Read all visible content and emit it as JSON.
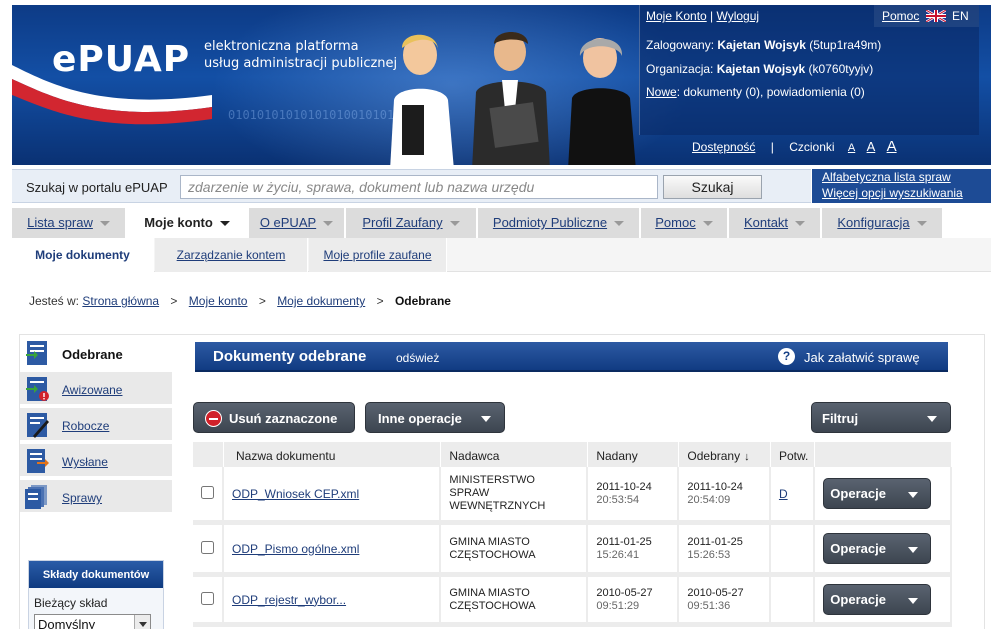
{
  "header": {
    "logo": "ePUAP",
    "tagline_line1": "elektroniczna platforma",
    "tagline_line2": "usług administracji publicznej",
    "binary": "0101010101010101001010101",
    "links": {
      "my_account": "Moje Konto",
      "logout": "Wyloguj",
      "help": "Pomoc",
      "lang": "EN"
    },
    "logged_label": "Zalogowany:",
    "logged_name": "Kajetan Wojsyk",
    "logged_id": "(5tup1ra49m)",
    "org_label": "Organizacja:",
    "org_name": "Kajetan Wojsyk",
    "org_id": "(k0760tyyjv)",
    "new_label": "Nowe",
    "new_text": ": dokumenty (0), powiadomienia (0)",
    "accessibility": "Dostępność",
    "fonts_label": "Czcionki",
    "font_small": "A",
    "font_medium": "A",
    "font_large": "A"
  },
  "search": {
    "label": "Szukaj w portalu ePUAP",
    "placeholder": "zdarzenie w życiu, sprawa, dokument lub nazwa urzędu",
    "button": "Szukaj",
    "alpha_list": "Alfabetyczna lista spraw",
    "more_options": "Więcej opcji wyszukiwania"
  },
  "mainnav": [
    {
      "label": "Lista spraw"
    },
    {
      "label": "Moje konto"
    },
    {
      "label": "O ePUAP"
    },
    {
      "label": "Profil Zaufany"
    },
    {
      "label": "Podmioty Publiczne"
    },
    {
      "label": "Pomoc"
    },
    {
      "label": "Kontakt"
    },
    {
      "label": "Konfiguracja"
    }
  ],
  "subnav": [
    {
      "label": "Moje dokumenty"
    },
    {
      "label": "Zarządzanie kontem"
    },
    {
      "label": "Moje profile zaufane"
    }
  ],
  "breadcrumb": {
    "prefix": "Jesteś w:",
    "items": [
      "Strona główna",
      "Moje konto",
      "Moje dokumenty"
    ],
    "current": "Odebrane",
    "separator": ">"
  },
  "sidebar": {
    "items": [
      {
        "label": "Odebrane",
        "icon": "inbox-icon"
      },
      {
        "label": "Awizowane",
        "icon": "notice-icon"
      },
      {
        "label": "Robocze",
        "icon": "draft-icon"
      },
      {
        "label": "Wysłane",
        "icon": "sent-icon"
      },
      {
        "label": "Sprawy",
        "icon": "cases-icon"
      }
    ],
    "warehouse": {
      "title": "Składy dokumentów",
      "current_label": "Bieżący skład",
      "current_value": "Domyślny"
    }
  },
  "documents": {
    "title": "Dokumenty odebrane",
    "refresh": "odśwież",
    "help": "Jak załatwić sprawę",
    "delete_button": "Usuń zaznaczone",
    "other_button": "Inne operacje",
    "filter_button": "Filtruj",
    "columns": [
      "Nazwa dokumentu",
      "Nadawca",
      "Nadany",
      "Odebrany",
      "Potw."
    ],
    "sort_arrow": "↓",
    "rows": [
      {
        "name": "ODP_Wniosek CEP.xml",
        "sender": "MINISTERSTWO SPRAW WEWNĘTRZNYCH",
        "sent_date": "2011-10-24",
        "sent_time": "20:53:54",
        "recv_date": "2011-10-24",
        "recv_time": "20:54:09",
        "confirm": "D",
        "op": "Operacje"
      },
      {
        "name": "ODP_Pismo ogólne.xml",
        "sender": "GMINA MIASTO CZĘSTOCHOWA",
        "sent_date": "2011-01-25",
        "sent_time": "15:26:41",
        "recv_date": "2011-01-25",
        "recv_time": "15:26:53",
        "confirm": "",
        "op": "Operacje"
      },
      {
        "name": "ODP_rejestr_wybor...",
        "sender": "GMINA MIASTO CZĘSTOCHOWA",
        "sent_date": "2010-05-27",
        "sent_time": "09:51:29",
        "recv_date": "2010-05-27",
        "recv_time": "09:51:36",
        "confirm": "",
        "op": "Operacje"
      }
    ]
  },
  "colors": {
    "header_blue": "#134fa5",
    "nav_gray": "#dcdcdc",
    "dark_button": "#4a525d",
    "accent_red": "#d1212a"
  }
}
